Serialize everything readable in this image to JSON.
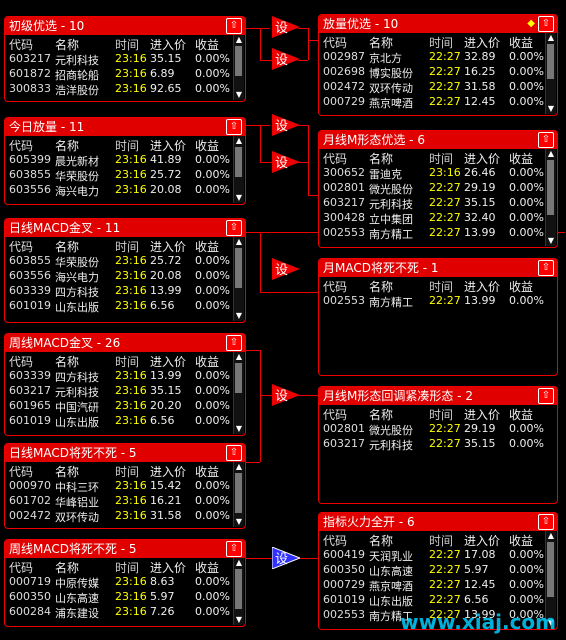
{
  "headers": [
    "代码",
    "名称",
    "时间",
    "进入价",
    "收益"
  ],
  "gate_label": "设",
  "watermark": "www.xiaj.com",
  "colors": {
    "accent": "#e00000",
    "time": "#ffff00",
    "blue_gate": "#3030ff"
  },
  "left_panels": [
    {
      "title": "初级优选 - 10",
      "rows": [
        [
          "603217",
          "元利科技",
          "23:16",
          "35.15",
          "0.00%"
        ],
        [
          "601872",
          "招商轮船",
          "23:16",
          "6.89",
          "0.00%"
        ],
        [
          "300833",
          "浩洋股份",
          "23:16",
          "92.65",
          "0.00%"
        ]
      ]
    },
    {
      "title": "今日放量 - 11",
      "rows": [
        [
          "605399",
          "晨光新材",
          "23:16",
          "41.89",
          "0.00%"
        ],
        [
          "603855",
          "华荣股份",
          "23:16",
          "25.72",
          "0.00%"
        ],
        [
          "603556",
          "海兴电力",
          "23:16",
          "20.08",
          "0.00%"
        ]
      ]
    },
    {
      "title": "日线MACD金叉 - 11",
      "rows": [
        [
          "603855",
          "华荣股份",
          "23:16",
          "25.72",
          "0.00%"
        ],
        [
          "603556",
          "海兴电力",
          "23:16",
          "20.08",
          "0.00%"
        ],
        [
          "603339",
          "四方科技",
          "23:16",
          "13.99",
          "0.00%"
        ],
        [
          "601019",
          "山东出版",
          "23:16",
          "6.56",
          "0.00%"
        ]
      ]
    },
    {
      "title": "周线MACD金叉 - 26",
      "rows": [
        [
          "603339",
          "四方科技",
          "23:16",
          "13.99",
          "0.00%"
        ],
        [
          "603217",
          "元利科技",
          "23:16",
          "35.15",
          "0.00%"
        ],
        [
          "601965",
          "中国汽研",
          "23:16",
          "20.20",
          "0.00%"
        ],
        [
          "601019",
          "山东出版",
          "23:16",
          "6.56",
          "0.00%"
        ]
      ]
    },
    {
      "title": "日线MACD将死不死 - 5",
      "rows": [
        [
          "000970",
          "中科三环",
          "23:16",
          "15.42",
          "0.00%"
        ],
        [
          "601702",
          "华峰铝业",
          "23:16",
          "16.21",
          "0.00%"
        ],
        [
          "002472",
          "双环传动",
          "23:16",
          "31.58",
          "0.00%"
        ]
      ]
    },
    {
      "title": "周线MACD将死不死 - 5",
      "rows": [
        [
          "000719",
          "中原传媒",
          "23:16",
          "8.63",
          "0.00%"
        ],
        [
          "600350",
          "山东高速",
          "23:16",
          "5.97",
          "0.00%"
        ],
        [
          "600284",
          "浦东建设",
          "23:16",
          "7.26",
          "0.00%"
        ]
      ]
    }
  ],
  "right_panels": [
    {
      "title": "放量优选 - 10",
      "rows": [
        [
          "002987",
          "京北方",
          "22:27",
          "32.89",
          "0.00%"
        ],
        [
          "002698",
          "博实股份",
          "22:27",
          "16.25",
          "0.00%"
        ],
        [
          "002472",
          "双环传动",
          "22:27",
          "31.58",
          "0.00%"
        ],
        [
          "000729",
          "燕京啤酒",
          "22:27",
          "12.45",
          "0.00%"
        ]
      ]
    },
    {
      "title": "月线M形态优选 - 6",
      "rows": [
        [
          "300652",
          "雷迪克",
          "23:16",
          "26.46",
          "0.00%"
        ],
        [
          "002801",
          "微光股份",
          "22:27",
          "29.19",
          "0.00%"
        ],
        [
          "603217",
          "元利科技",
          "22:27",
          "35.15",
          "0.00%"
        ],
        [
          "300428",
          "立中集团",
          "22:27",
          "32.40",
          "0.00%"
        ],
        [
          "002553",
          "南方精工",
          "22:27",
          "13.99",
          "0.00%"
        ]
      ]
    },
    {
      "title": "月MACD将死不死 - 1",
      "rows": [
        [
          "002553",
          "南方精工",
          "22:27",
          "13.99",
          "0.00%"
        ]
      ]
    },
    {
      "title": "月线M形态回调紧凑形态 - 2",
      "rows": [
        [
          "002801",
          "微光股份",
          "22:27",
          "29.19",
          "0.00%"
        ],
        [
          "603217",
          "元利科技",
          "22:27",
          "35.15",
          "0.00%"
        ]
      ]
    },
    {
      "title": "指标火力全开 - 6",
      "rows": [
        [
          "600419",
          "天润乳业",
          "22:27",
          "17.08",
          "0.00%"
        ],
        [
          "600350",
          "山东高速",
          "22:27",
          "5.97",
          "0.00%"
        ],
        [
          "000729",
          "燕京啤酒",
          "22:27",
          "12.45",
          "0.00%"
        ],
        [
          "601019",
          "山东出版",
          "22:27",
          "6.56",
          "0.00%"
        ],
        [
          "002553",
          "南方精工",
          "22:27",
          "13.99",
          "0.00%"
        ]
      ]
    }
  ]
}
